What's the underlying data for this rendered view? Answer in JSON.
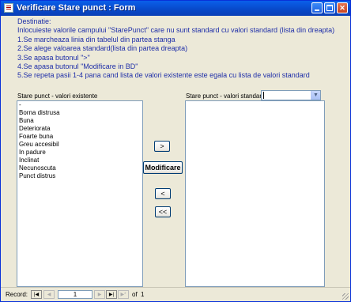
{
  "window": {
    "title": "Verificare Stare punct : Form"
  },
  "instructions": {
    "lines": [
      "Destinatie:",
      "Inlocuieste valorile campului  \"StarePunct\" care nu sunt standard cu valori standard (lista din dreapta)",
      "1.Se marcheaza linia din tabelul din partea stanga",
      "2.Se alege valoarea standard(lista din partea dreapta)",
      "3.Se apasa butonul \">\"",
      "4.Se apasa butonul \"Modificare in BD\"",
      "5.Se repeta pasii 1-4 pana   cand lista de valori existente este egala cu lista de valori standard"
    ]
  },
  "left_list": {
    "label": "Stare punct - valori existente",
    "items": [
      "-",
      "Borna distrusa",
      "Buna",
      "Deteriorata",
      "Foarte buna",
      "Greu accesibil",
      "In padure",
      "Inclinat",
      "Necunoscuta",
      "Punct distrus"
    ]
  },
  "right_list": {
    "label": "Stare punct - valori standard",
    "combo_value": "",
    "items": []
  },
  "buttons": {
    "move_right": ">",
    "modify": "Modificare",
    "move_left": "<",
    "move_all_left": "<<"
  },
  "navigation": {
    "record_label": "Record:",
    "current_record": "1",
    "of_label": "of",
    "total_records": "1",
    "icons": {
      "first": "first-record-icon",
      "prev": "previous-record-icon",
      "next": "next-record-icon",
      "last": "last-record-icon",
      "new": "new-record-icon"
    }
  },
  "colors": {
    "instruction_text": "#1E2EA8",
    "form_background": "#ECE9D8",
    "titlebar": "#0848C8"
  }
}
